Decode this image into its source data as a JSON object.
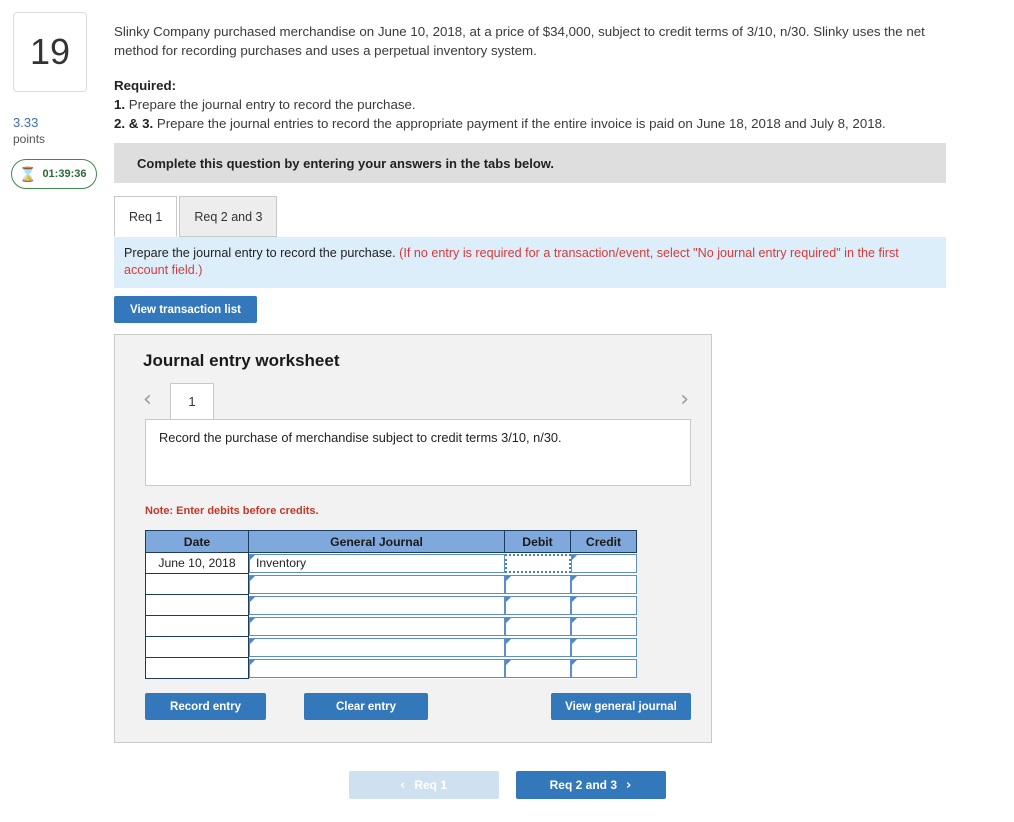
{
  "left_rail": {
    "question_number": "19",
    "points_value": "3.33",
    "points_label": "points",
    "timer": "01:39:36",
    "timer_icon": "hourglass-icon"
  },
  "question": {
    "body": "Slinky Company purchased merchandise on June 10, 2018, at a price of $34,000, subject to credit terms of 3/10, n/30. Slinky uses the net method for recording purchases and uses a perpetual inventory system.",
    "required_heading": "Required:",
    "req1_lead": "1.",
    "req1_text": " Prepare the journal entry to record the purchase.",
    "req23_lead": "2. & 3.",
    "req23_text": " Prepare the journal entries to record the appropriate payment if the entire invoice is paid on June 18, 2018 and July 8, 2018."
  },
  "banner": {
    "text": "Complete this question by entering your answers in the tabs below."
  },
  "tabs": [
    {
      "label": "Req 1",
      "active": true
    },
    {
      "label": "Req 2 and 3",
      "active": false
    }
  ],
  "instruction": {
    "black_text": "Prepare the journal entry to record the purchase. ",
    "red_text": "(If no entry is required for a transaction/event, select \"No journal entry required\" in the first account field.)"
  },
  "toolbar": {
    "view_transaction_list_label": "View transaction list"
  },
  "worksheet": {
    "title": "Journal entry worksheet",
    "pager": {
      "prev_icon": "chevron-left-icon",
      "next_icon": "chevron-right-icon",
      "current_page": "1"
    },
    "transaction_description": "Record the purchase of merchandise subject to credit terms 3/10, n/30.",
    "note": "Note: Enter debits before credits.",
    "table": {
      "headers": [
        "Date",
        "General Journal",
        "Debit",
        "Credit"
      ],
      "rows": [
        {
          "date": "June 10, 2018",
          "general_journal": "Inventory",
          "debit": "",
          "credit": "",
          "debit_selected": true
        },
        {
          "date": "",
          "general_journal": "",
          "debit": "",
          "credit": "",
          "debit_selected": false
        },
        {
          "date": "",
          "general_journal": "",
          "debit": "",
          "credit": "",
          "debit_selected": false
        },
        {
          "date": "",
          "general_journal": "",
          "debit": "",
          "credit": "",
          "debit_selected": false
        },
        {
          "date": "",
          "general_journal": "",
          "debit": "",
          "credit": "",
          "debit_selected": false
        },
        {
          "date": "",
          "general_journal": "",
          "debit": "",
          "credit": "",
          "debit_selected": false
        }
      ]
    },
    "buttons": {
      "record_entry": "Record entry",
      "clear_entry": "Clear entry",
      "view_general_journal": "View general journal"
    }
  },
  "bottom_nav": {
    "prev_label": "Req 1",
    "next_label": "Req 2 and 3",
    "prev_icon": "chevron-left-icon",
    "next_icon": "chevron-right-icon"
  },
  "colors": {
    "primary_blue": "#3478bc",
    "table_header_blue": "#7fa9dc",
    "instruction_bg": "#ddeefb",
    "banner_gray": "#dedede",
    "red_text": "#d83a3a",
    "timer_green": "#3f8a4f"
  }
}
